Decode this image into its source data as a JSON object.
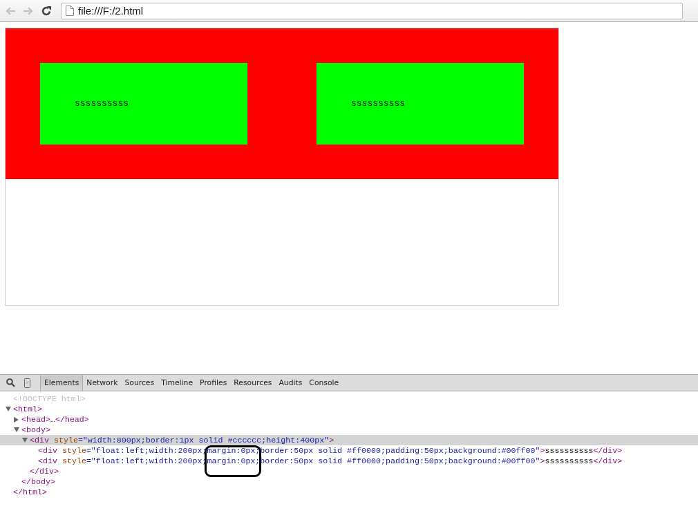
{
  "browser": {
    "back_disabled": true,
    "forward_disabled": true,
    "url": "file:///F:/2.html"
  },
  "page": {
    "boxes": [
      {
        "text": "ssssssssss"
      },
      {
        "text": "ssssssssss"
      }
    ]
  },
  "devtools": {
    "tabs": [
      {
        "label": "Elements",
        "selected": true
      },
      {
        "label": "Network",
        "selected": false
      },
      {
        "label": "Sources",
        "selected": false
      },
      {
        "label": "Timeline",
        "selected": false
      },
      {
        "label": "Profiles",
        "selected": false
      },
      {
        "label": "Resources",
        "selected": false
      },
      {
        "label": "Audits",
        "selected": false
      },
      {
        "label": "Console",
        "selected": false
      }
    ],
    "dom_tree": [
      {
        "selected": false,
        "open": [
          {
            "kind": "doctype",
            "text": "<!DOCTYPE html>"
          }
        ]
      },
      {
        "selected": false,
        "expanded": true,
        "open": [
          {
            "kind": "tag",
            "text": "<html>"
          }
        ],
        "close": [
          {
            "kind": "tag",
            "text": "</html>"
          }
        ],
        "children": [
          {
            "selected": false,
            "expanded": false,
            "open": [
              {
                "kind": "tag",
                "text": "<head>"
              },
              {
                "kind": "text",
                "text": "…"
              },
              {
                "kind": "tag",
                "text": "</head>"
              }
            ]
          },
          {
            "selected": false,
            "expanded": true,
            "open": [
              {
                "kind": "tag",
                "text": "<body>"
              }
            ],
            "close": [
              {
                "kind": "tag",
                "text": "</body>"
              }
            ],
            "children": [
              {
                "selected": true,
                "expanded": true,
                "open": [
                  {
                    "kind": "tag",
                    "text": "<div"
                  },
                  {
                    "kind": "attr",
                    "text": " style"
                  },
                  {
                    "kind": "value",
                    "text": "=\"width:800px;border:1px solid #cccccc;height:400px\""
                  },
                  {
                    "kind": "tag",
                    "text": ">"
                  }
                ],
                "close": [
                  {
                    "kind": "tag",
                    "text": "</div>"
                  }
                ],
                "children": [
                  {
                    "selected": false,
                    "open": [
                      {
                        "kind": "tag",
                        "text": "<div"
                      },
                      {
                        "kind": "attr",
                        "text": " style"
                      },
                      {
                        "kind": "value",
                        "text": "=\"float:left;width:200px;margin:0px;border:50px solid #ff0000;padding:50px;background:#00ff00\""
                      },
                      {
                        "kind": "tag",
                        "text": ">"
                      },
                      {
                        "kind": "text",
                        "text": "ssssssssss"
                      },
                      {
                        "kind": "tag",
                        "text": "</div>"
                      }
                    ]
                  },
                  {
                    "selected": false,
                    "open": [
                      {
                        "kind": "tag",
                        "text": "<div"
                      },
                      {
                        "kind": "attr",
                        "text": " style"
                      },
                      {
                        "kind": "value",
                        "text": "=\"float:left;width:200px;margin:0px;border:50px solid #ff0000;padding:50px;background:#00ff00\""
                      },
                      {
                        "kind": "tag",
                        "text": ">"
                      },
                      {
                        "kind": "text",
                        "text": "ssssssssss"
                      },
                      {
                        "kind": "tag",
                        "text": "</div>"
                      }
                    ]
                  }
                ]
              }
            ]
          }
        ]
      }
    ]
  }
}
